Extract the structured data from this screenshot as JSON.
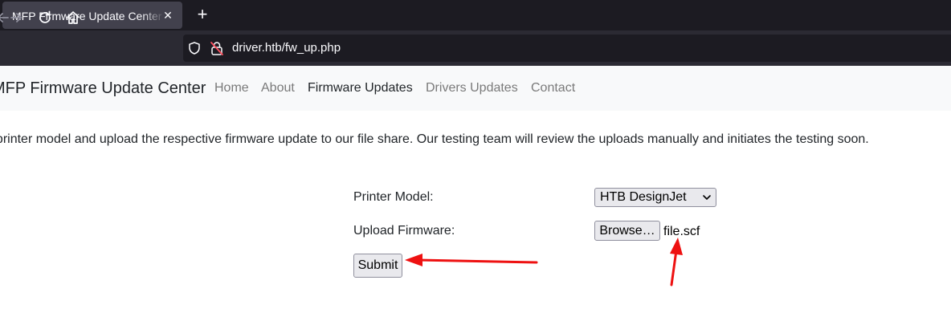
{
  "browser": {
    "tab_title": "MFP Firmware Update Center",
    "tab_close": "✕",
    "new_tab": "+",
    "url": "driver.htb/fw_up.php"
  },
  "site": {
    "brand": "MFP Firmware Update Center",
    "nav": [
      {
        "label": "Home",
        "active": false
      },
      {
        "label": "About",
        "active": false
      },
      {
        "label": "Firmware Updates",
        "active": true
      },
      {
        "label": "Drivers Updates",
        "active": false
      },
      {
        "label": "Contact",
        "active": false
      }
    ]
  },
  "page": {
    "intro": "Select printer model and upload the respective firmware update to our file share. Our testing team will review the uploads manually and initiates the testing soon.",
    "form": {
      "printer_label": "Printer Model:",
      "printer_selected": "HTB DesignJet",
      "upload_label": "Upload Firmware:",
      "browse_label": "Browse…",
      "file_name": "file.scf",
      "submit_label": "Submit"
    }
  },
  "colors": {
    "annotation_arrow": "#ee1111",
    "tab_bar": "#1c1b22",
    "toolbar": "#2b2a33",
    "header_bg": "#f8f9fa"
  }
}
